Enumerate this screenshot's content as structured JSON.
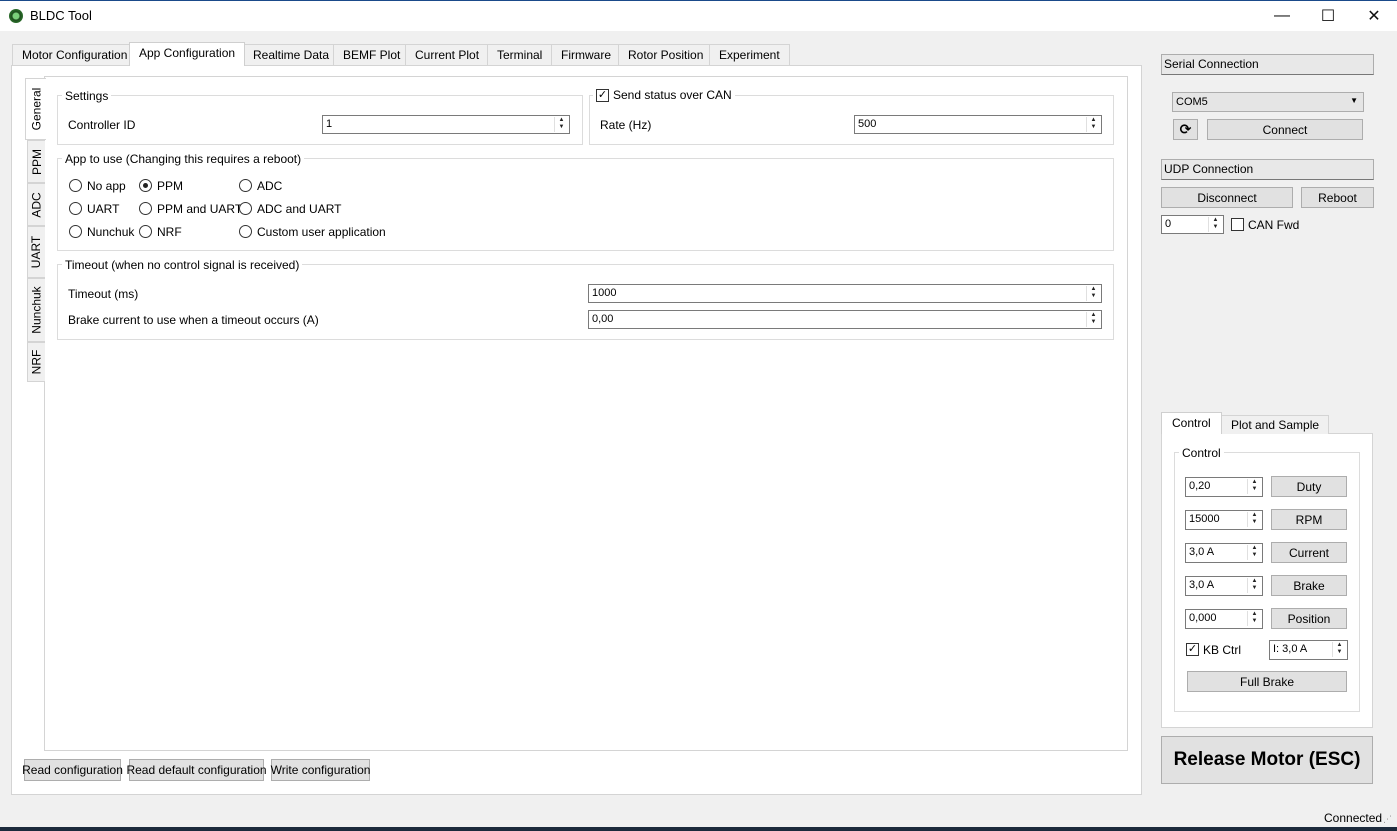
{
  "window": {
    "title": "BLDC Tool",
    "minimize": "—",
    "maximize": "☐",
    "close": "✕"
  },
  "tabs": [
    "Motor Configuration",
    "App Configuration",
    "Realtime Data",
    "BEMF Plot",
    "Current Plot",
    "Terminal",
    "Firmware",
    "Rotor Position",
    "Experiment"
  ],
  "active_tab": "App Configuration",
  "vertical_tabs": [
    "General",
    "PPM",
    "ADC",
    "UART",
    "Nunchuk",
    "NRF"
  ],
  "settings": {
    "title": "Settings",
    "controller_id_label": "Controller ID",
    "controller_id_value": "1"
  },
  "can": {
    "title": "Send status over CAN",
    "checked": true,
    "rate_label": "Rate (Hz)",
    "rate_value": "500"
  },
  "app_to_use": {
    "title": "App to use (Changing this requires a reboot)",
    "options": [
      "No app",
      "PPM",
      "ADC",
      "UART",
      "PPM and UART",
      "ADC and UART",
      "Nunchuk",
      "NRF",
      "Custom user application"
    ],
    "selected": "PPM"
  },
  "timeout": {
    "title": "Timeout (when no control signal is received)",
    "timeout_label": "Timeout (ms)",
    "timeout_value": "1000",
    "brake_label": "Brake current to use when a timeout occurs (A)",
    "brake_value": "0,00"
  },
  "bottom_buttons": {
    "read": "Read configuration",
    "read_default": "Read default configuration",
    "write": "Write configuration"
  },
  "serial": {
    "header": "Serial Connection",
    "port": "COM5",
    "connect": "Connect",
    "refresh_icon": "refresh-icon"
  },
  "udp": {
    "header": "UDP Connection",
    "disconnect": "Disconnect",
    "reboot": "Reboot",
    "can_id": "0",
    "can_fwd": "CAN Fwd",
    "can_fwd_checked": false
  },
  "control_tabs": [
    "Control",
    "Plot and Sample"
  ],
  "control": {
    "title": "Control",
    "duty_value": "0,20",
    "duty_btn": "Duty",
    "rpm_value": "15000",
    "rpm_btn": "RPM",
    "current_value": "3,0 A",
    "current_btn": "Current",
    "brake_value": "3,0 A",
    "brake_btn": "Brake",
    "position_value": "0,000",
    "position_btn": "Position",
    "kb_ctrl": "KB Ctrl",
    "kb_ctrl_checked": true,
    "kb_current": "I: 3,0 A",
    "full_brake": "Full Brake"
  },
  "release_button": "Release Motor (ESC)",
  "status": "Connected"
}
